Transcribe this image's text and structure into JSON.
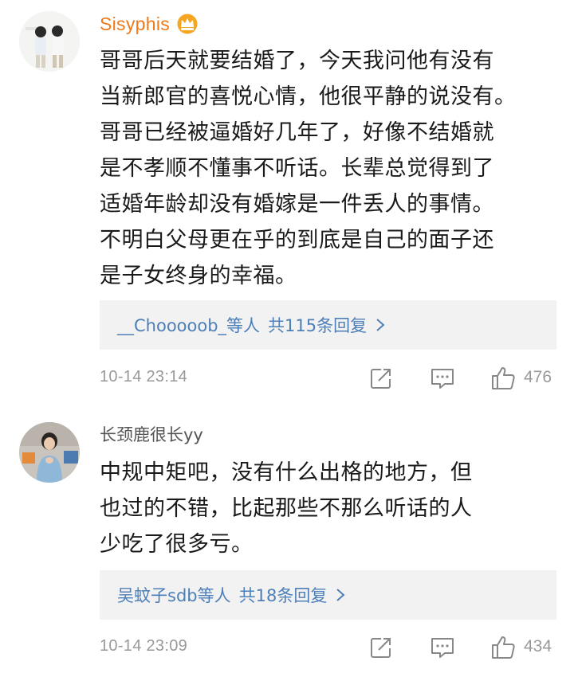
{
  "comments": [
    {
      "username": "Sisyphis",
      "badge_icon": "crown-badge-icon",
      "text_lines": [
        "哥哥后天就要结婚了，今天我问他有没有",
        "当新郎官的喜悦心情，他很平静的说没有。",
        "哥哥已经被逼婚好几年了，好像不结婚就",
        "是不孝顺不懂事不听话。长辈总觉得到了",
        "适婚年龄却没有婚嫁是一件丢人的事情。",
        "不明白父母更在乎的到底是自己的面子还",
        "是子女终身的幸福。"
      ],
      "replies_users": "__Chooooob_等人",
      "replies_count": "共115条回复",
      "time": "10-14 23:14",
      "likes": "476"
    },
    {
      "username": "长颈鹿很长yy",
      "text_lines": [
        "中规中矩吧，没有什么出格的地方，但",
        "也过的不错，比起那些不那么听话的人",
        "少吃了很多亏。"
      ],
      "replies_users": "吴蚊子sdb等人",
      "replies_count": "共18条回复",
      "time": "10-14 23:09",
      "likes": "434"
    }
  ],
  "colors": {
    "vip_username": "#ef7a1a",
    "username": "#555555",
    "link": "#4d7fb8",
    "meta": "#999999",
    "reply_box_bg": "#f2f2f2"
  }
}
